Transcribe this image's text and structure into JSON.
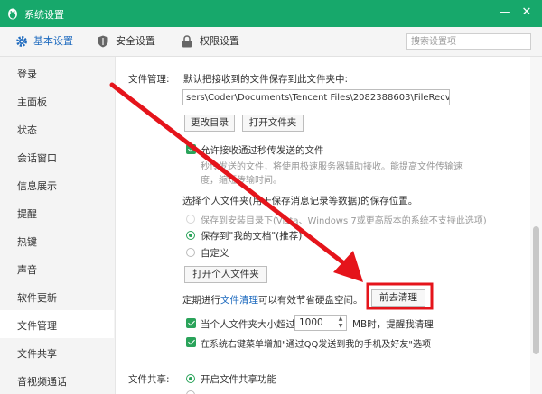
{
  "window": {
    "title": "系统设置",
    "minimize_glyph": "—",
    "close_glyph": "✕"
  },
  "tabs": [
    {
      "label": "基本设置",
      "icon": "gear-icon",
      "active": true
    },
    {
      "label": "安全设置",
      "icon": "shield-icon",
      "active": false
    },
    {
      "label": "权限设置",
      "icon": "lock-icon",
      "active": false
    }
  ],
  "search": {
    "placeholder": "搜索设置项"
  },
  "sidebar": {
    "items": [
      {
        "label": "登录"
      },
      {
        "label": "主面板"
      },
      {
        "label": "状态"
      },
      {
        "label": "会话窗口"
      },
      {
        "label": "信息展示"
      },
      {
        "label": "提醒"
      },
      {
        "label": "热键"
      },
      {
        "label": "声音"
      },
      {
        "label": "软件更新"
      },
      {
        "label": "文件管理",
        "active": true
      },
      {
        "label": "文件共享"
      },
      {
        "label": "音视频通话"
      }
    ]
  },
  "file_mgmt": {
    "section_label": "文件管理:",
    "default_save_label": "默认把接收到的文件保存到此文件夹中:",
    "path_value": "sers\\Coder\\Documents\\Tencent Files\\2082388603\\FileRecv\\",
    "change_dir_button": "更改目录",
    "open_folder_button": "打开文件夹",
    "allow_flash_label": "允许接收通过秒传发送的文件",
    "flash_desc_line1": "秒传发送的文件，将使用极速服务器辅助接收。能提高文件传输速",
    "flash_desc_line2": "度，缩短传输时间。",
    "personal_folder_label": "选择个人文件夹(用于保存消息记录等数据)的保存位置。",
    "save_to_install_option": "保存到安装目录下(Vista、Windows 7或更高版本的系统不支持此选项)",
    "save_to_docs_option": "保存到\"我的文档\"(推荐)",
    "custom_option": "自定义",
    "open_personal_button": "打开个人文件夹",
    "clean_label_before": "定期进行",
    "clean_link": "文件清理",
    "clean_label_after": "可以有效节省硬盘空间。",
    "clean_button": "前去清理",
    "size_limit_before": "当个人文件夹大小超过",
    "size_limit_value": "1000",
    "size_limit_after": "MB时，提醒我清理",
    "context_menu_label": "在系统右键菜单增加\"通过QQ发送到我的手机及好友\"选项"
  },
  "file_share": {
    "section_label": "文件共享:",
    "enable_label": "开启文件共享功能"
  },
  "colors": {
    "titlebar": "#17a86b",
    "accent_blue": "#1f6bbf",
    "checkbox_green": "#2aa35a",
    "annotation_red": "#e5141b"
  }
}
